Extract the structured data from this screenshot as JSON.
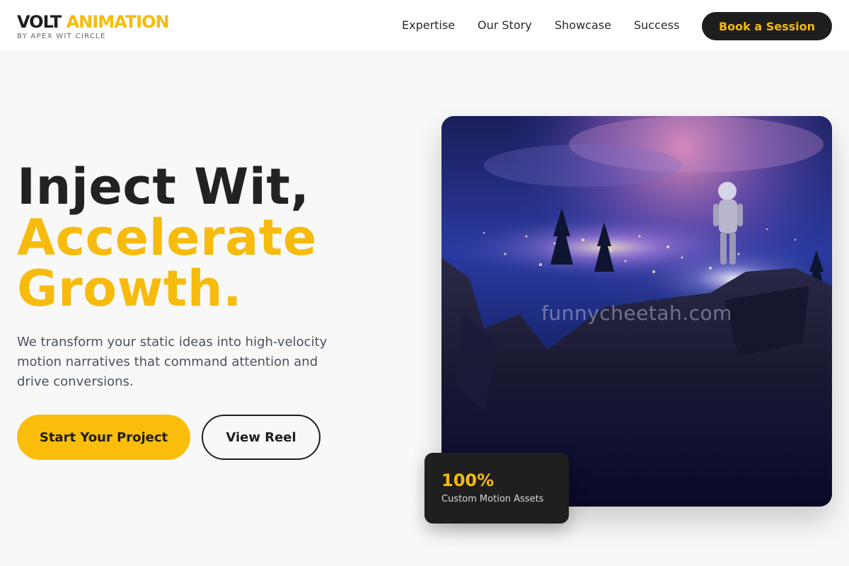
{
  "brand": {
    "name_part1": "VOLT",
    "name_part2": "ANIMATION",
    "tagline": "BY APEX WIT CIRCLE",
    "accent_color": "#f6bb0c",
    "dark_color": "#1e1e1e"
  },
  "nav": {
    "links": [
      {
        "label": "Expertise"
      },
      {
        "label": "Our Story"
      },
      {
        "label": "Showcase"
      },
      {
        "label": "Success"
      }
    ],
    "cta_label": "Book a Session"
  },
  "hero": {
    "headline_line1": "Inject Wit,",
    "headline_line2": "Accelerate",
    "headline_line3": "Growth.",
    "description": "We transform your static ideas into high-velocity motion narratives that command attention and drive conversions.",
    "primary_button": "Start Your Project",
    "secondary_button": "View Reel",
    "image_watermark": "funnycheetah.com"
  },
  "stat": {
    "value": "100%",
    "label": "Custom Motion Assets"
  }
}
